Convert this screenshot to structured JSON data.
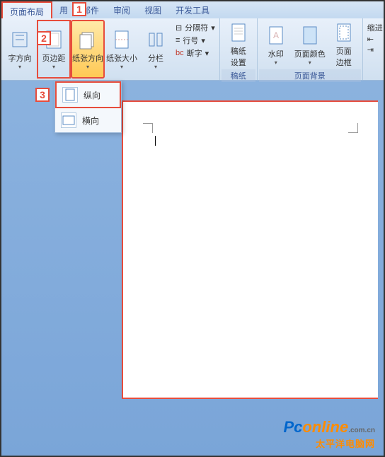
{
  "tabs": {
    "layout": "页面布局",
    "references": "用",
    "mail": "邮件",
    "review": "审阅",
    "view": "视图",
    "dev": "开发工具"
  },
  "ribbon": {
    "textdir": "字方向",
    "margins": "页边距",
    "orientation": "纸张方向",
    "size": "纸张大小",
    "columns": "分栏",
    "breaks": "分隔符",
    "linenum": "行号",
    "hyphen": "断字",
    "paper_setup": "稿纸\n设置",
    "watermark": "水印",
    "pagecolor": "页面颜色",
    "border": "页面\n边框",
    "indent": "缩进"
  },
  "groups": {
    "paper": "稿纸",
    "pagebg": "页面背景"
  },
  "dropdown": {
    "portrait": "纵向",
    "landscape": "横向"
  },
  "markers": {
    "m1": "1",
    "m2": "2",
    "m3": "3"
  },
  "watermark": {
    "brand_pc": "Pc",
    "brand_on": "online",
    "brand_cn": ".com.cn",
    "sub": "太平洋电脑网"
  }
}
